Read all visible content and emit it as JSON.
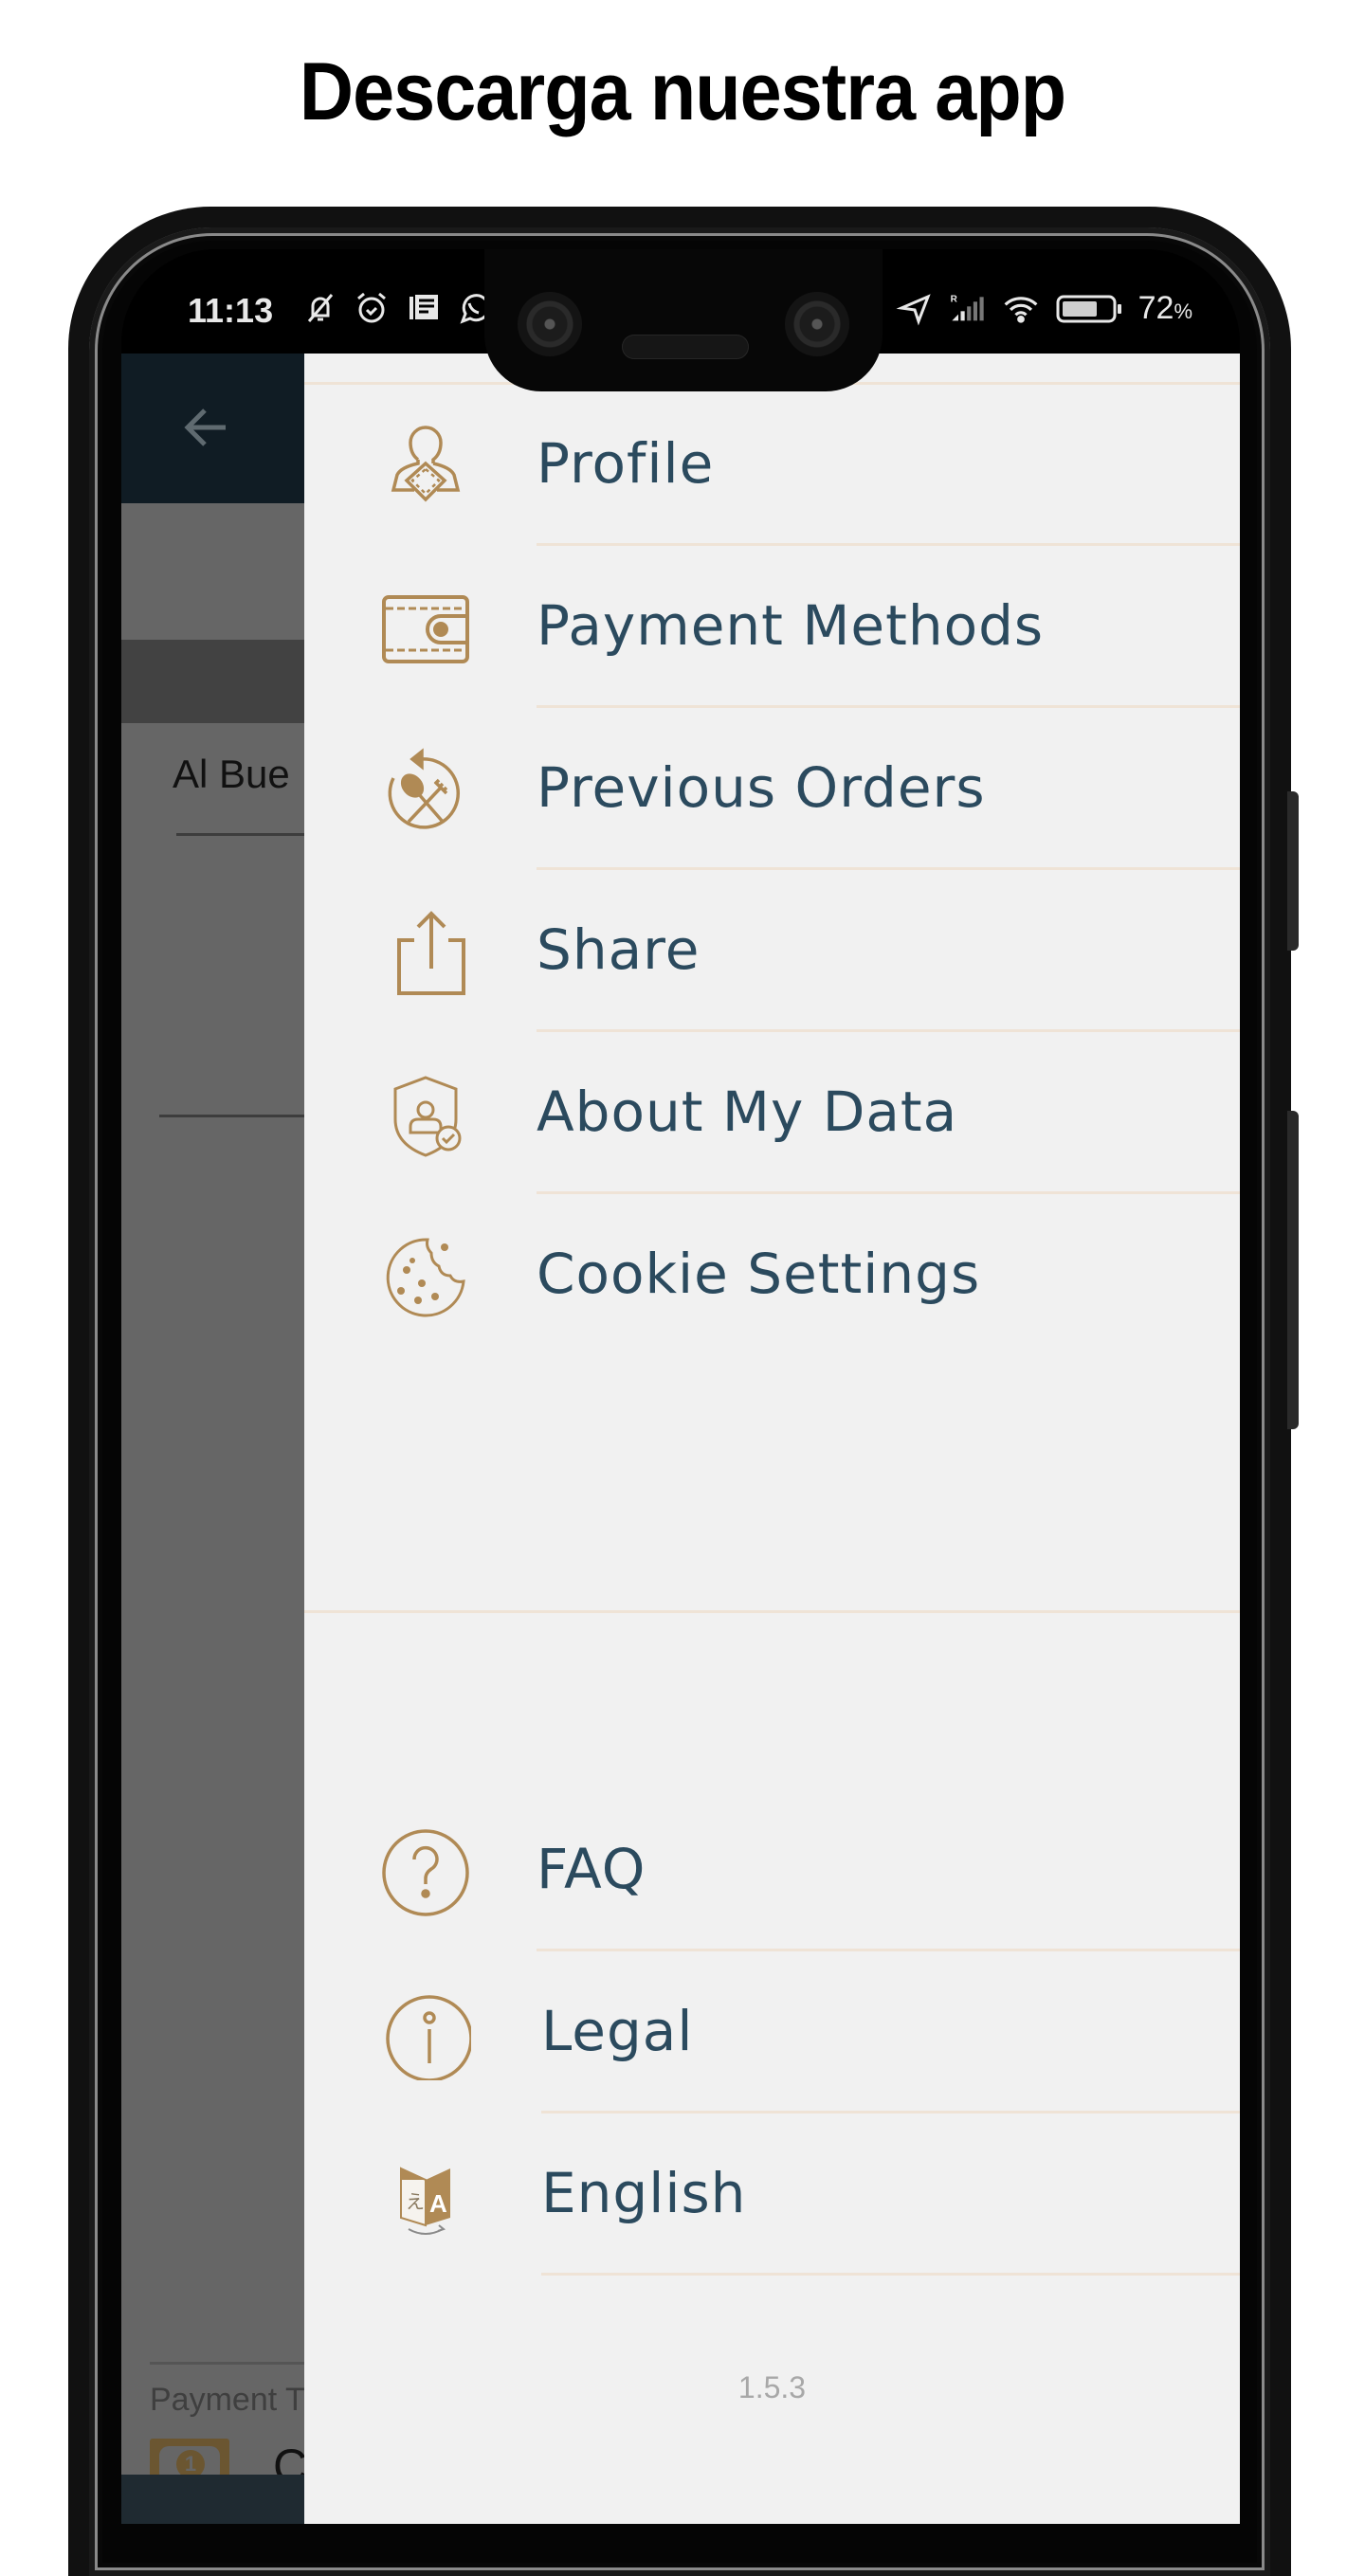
{
  "page": {
    "headline": "Descarga nuestra app"
  },
  "status_bar": {
    "time": "11:13",
    "left_icons": [
      "bell-off-icon",
      "alarm-icon",
      "news-icon",
      "whatsapp-icon"
    ],
    "right_icons": [
      "location-icon",
      "signal-roaming-icon",
      "wifi-icon",
      "battery-icon"
    ],
    "roaming_label": "R",
    "battery_percent": "72",
    "battery_suffix": "%",
    "battery_level": 0.72
  },
  "background_app": {
    "back_icon": "arrow-left-icon",
    "title_partial": "Al Bue",
    "payment_label_partial": "Payment T",
    "cash_icon": "cash-icon",
    "cash_coin": "1",
    "payment_value_partial": "C"
  },
  "colors": {
    "accent_gold": "#b08a55",
    "label_navy": "#2b4a5e",
    "drawer_bg": "#f1f1f1",
    "separator": "#efe3d6",
    "topbar_dark": "#101c24"
  },
  "drawer": {
    "menu_top": [
      {
        "label": "Profile",
        "icon": "profile-icon"
      },
      {
        "label": "Payment Methods",
        "icon": "wallet-icon"
      },
      {
        "label": "Previous Orders",
        "icon": "previous-orders-icon"
      },
      {
        "label": "Share",
        "icon": "share-icon"
      },
      {
        "label": "About My Data",
        "icon": "data-privacy-icon"
      },
      {
        "label": "Cookie Settings",
        "icon": "cookie-icon"
      }
    ],
    "menu_bottom": [
      {
        "label": "FAQ",
        "icon": "question-icon"
      },
      {
        "label": "Legal",
        "icon": "info-icon"
      },
      {
        "label": "English",
        "icon": "translate-icon"
      }
    ],
    "version": "1.5.3"
  }
}
